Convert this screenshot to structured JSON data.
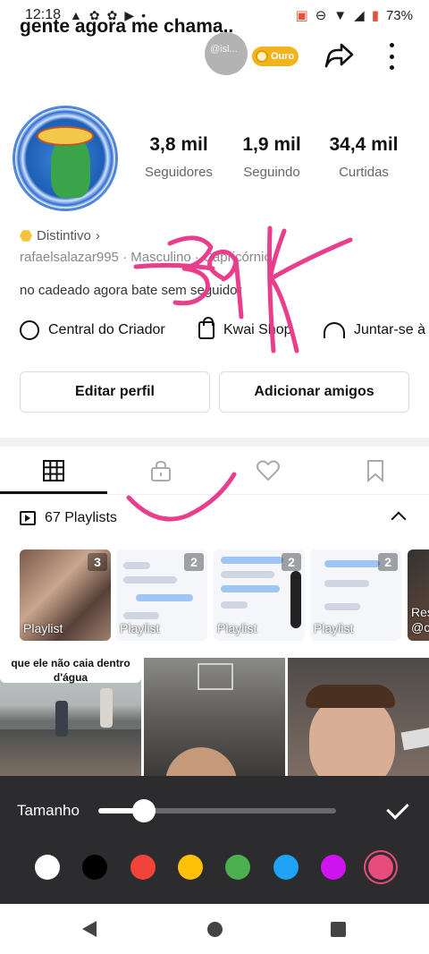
{
  "status_bar": {
    "time": "12:18",
    "battery": "73%"
  },
  "header": {
    "title": "gente agora me chama..",
    "overlay_text": "@isl...",
    "badge": "Ouro"
  },
  "stats": [
    {
      "value": "3,8 mil",
      "label": "Seguidores"
    },
    {
      "value": "1,9 mil",
      "label": "Seguindo"
    },
    {
      "value": "34,4 mil",
      "label": "Curtidas"
    }
  ],
  "profile": {
    "distintivo": "Distintivo",
    "userinfo": "rafaelsalazar995 · Masculino · Capricórnio",
    "bio": "no cadeado agora bate sem seguidor"
  },
  "links": {
    "creator": "Central do Criador",
    "shop": "Kwai Shop",
    "join": "Juntar-se à"
  },
  "buttons": {
    "edit": "Editar perfil",
    "add": "Adicionar amigos"
  },
  "playlists": {
    "header": "67 Playlists",
    "cards": [
      {
        "count": "3",
        "label": "Playlist"
      },
      {
        "count": "2",
        "label": "Playlist"
      },
      {
        "count": "2",
        "label": "Playlist"
      },
      {
        "count": "2",
        "label": "Playlist"
      },
      {
        "count": "",
        "label": "Res @c"
      }
    ]
  },
  "videos": [
    {
      "caption": "que ele não caia dentro d'água"
    }
  ],
  "draw_panel": {
    "label": "Tamanho",
    "size_fraction": 0.19,
    "colors": [
      "#ffffff",
      "#000000",
      "#f2433a",
      "#ffc107",
      "#4caf50",
      "#1ea3f5",
      "#d014f0",
      "#e84c7c"
    ],
    "selected_color": "#e84c7c"
  },
  "annotation": {
    "text": "39K",
    "color": "#e83e8c"
  }
}
